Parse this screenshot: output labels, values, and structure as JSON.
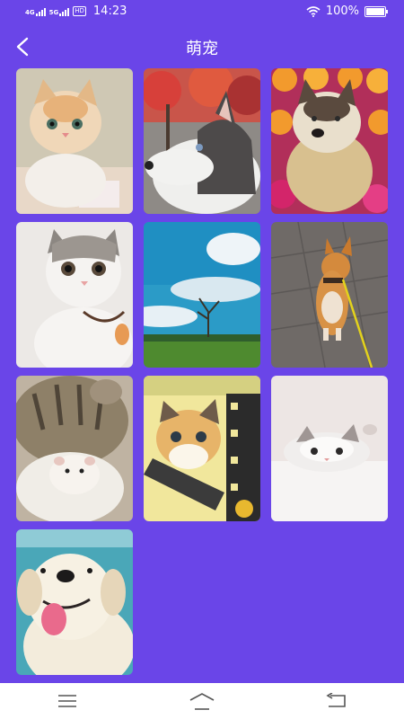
{
  "status_bar": {
    "network_1": "4G",
    "network_2": "5G",
    "hd_badge": "HD",
    "time": "14:23",
    "battery": "100%"
  },
  "header": {
    "title": "萌宠",
    "back_icon": "chevron-left-icon"
  },
  "gallery": {
    "photos": [
      {
        "subject": "orange-white kitten",
        "alt": "cat-photo"
      },
      {
        "subject": "husky with red autumn leaves",
        "alt": "dog-photo"
      },
      {
        "subject": "husky surrounded by orange roses",
        "alt": "dog-photo"
      },
      {
        "subject": "grey-white kitten looking up",
        "alt": "cat-photo"
      },
      {
        "subject": "landscape with bare tree and blue sky",
        "alt": "landscape-photo"
      },
      {
        "subject": "corgi on leash walking on pavement",
        "alt": "dog-photo"
      },
      {
        "subject": "tabby cat hugging a hamster",
        "alt": "cat-photo"
      },
      {
        "subject": "kitten on film strip with flowers",
        "alt": "cat-photo"
      },
      {
        "subject": "ragdoll kitten on white blanket",
        "alt": "cat-photo"
      },
      {
        "subject": "white puppy with tongue out",
        "alt": "dog-photo"
      }
    ]
  },
  "nav_bar": {
    "menu_icon": "menu-icon",
    "home_icon": "home-icon",
    "back_icon": "back-arrow-icon"
  },
  "colors": {
    "background": "#6a45e8",
    "nav_background": "#ffffff"
  }
}
